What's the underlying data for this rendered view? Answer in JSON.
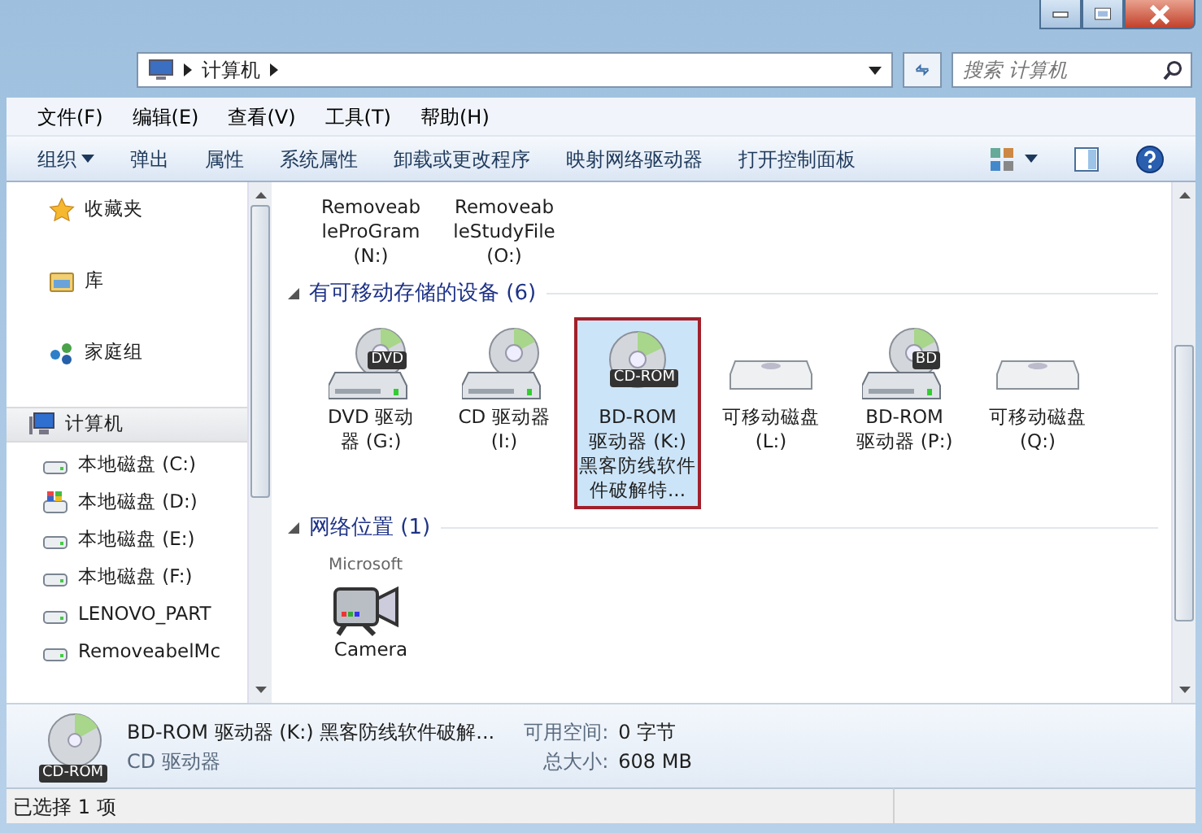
{
  "address_bar": {
    "path": [
      "计算机"
    ],
    "search_placeholder": "搜索 计算机"
  },
  "menu": [
    "文件(F)",
    "编辑(E)",
    "查看(V)",
    "工具(T)",
    "帮助(H)"
  ],
  "toolbar": [
    {
      "label": "组织",
      "dropdown": true
    },
    {
      "label": "弹出",
      "dropdown": false
    },
    {
      "label": "属性",
      "dropdown": false
    },
    {
      "label": "系统属性",
      "dropdown": false
    },
    {
      "label": "卸载或更改程序",
      "dropdown": false
    },
    {
      "label": "映射网络驱动器",
      "dropdown": false
    },
    {
      "label": "打开控制面板",
      "dropdown": false
    }
  ],
  "navigation": [
    {
      "label": "收藏夹",
      "kind": "star",
      "selected": false
    },
    {
      "label": "库",
      "kind": "library",
      "selected": false
    },
    {
      "label": "家庭组",
      "kind": "homegroup",
      "selected": false
    },
    {
      "label": "计算机",
      "kind": "computer",
      "selected": true,
      "children": [
        {
          "label": "本地磁盘 (C:)",
          "kind": "drive"
        },
        {
          "label": "本地磁盘 (D:)",
          "kind": "system-drive"
        },
        {
          "label": "本地磁盘 (E:)",
          "kind": "drive"
        },
        {
          "label": "本地磁盘 (F:)",
          "kind": "drive"
        },
        {
          "label": "LENOVO_PART",
          "kind": "drive"
        },
        {
          "label": "RemoveabelMc",
          "kind": "drive"
        }
      ]
    }
  ],
  "content": [
    {
      "items": [
        {
          "lines": [
            "Removeab",
            "leProGram",
            "(N:)"
          ],
          "kind": "none",
          "selected": false
        },
        {
          "lines": [
            "Removeab",
            "leStudyFile",
            "(O:)"
          ],
          "kind": "none",
          "selected": false
        }
      ]
    },
    {
      "title": "有可移动存储的设备",
      "count": "(6)",
      "expanded": true,
      "items": [
        {
          "lines": [
            "DVD 驱动",
            "器 (G:)"
          ],
          "kind": "optical",
          "badge": "DVD",
          "selected": false
        },
        {
          "lines": [
            "CD 驱动器",
            "(I:)"
          ],
          "kind": "optical",
          "selected": false
        },
        {
          "lines": [
            "BD-ROM",
            "驱动器 (K:)",
            "黑客防线软件",
            "件破解特..."
          ],
          "kind": "disc",
          "badge": "CD-ROM",
          "selected": true
        },
        {
          "lines": [
            "可移动磁盘",
            "(L:)"
          ],
          "kind": "removable",
          "selected": false
        },
        {
          "lines": [
            "BD-ROM",
            "驱动器 (P:)"
          ],
          "kind": "optical",
          "badge": "BD",
          "selected": false
        },
        {
          "lines": [
            "可移动磁盘",
            "(Q:)"
          ],
          "kind": "removable",
          "selected": false
        }
      ]
    },
    {
      "title": "网络位置",
      "count": "(1)",
      "expanded": true,
      "items": [
        {
          "lines": [
            "Camera"
          ],
          "kind": "camera",
          "badge": "Microsoft",
          "selected": false
        }
      ]
    }
  ],
  "details": {
    "badge": "CD-ROM",
    "name": "BD-ROM 驱动器 (K:) 黑客防线软件破解...",
    "type": "CD 驱动器",
    "fields": [
      {
        "label": "可用空间:",
        "value": "0 字节"
      },
      {
        "label": "总大小:",
        "value": "608 MB"
      }
    ]
  },
  "status_bar": "已选择 1 项"
}
